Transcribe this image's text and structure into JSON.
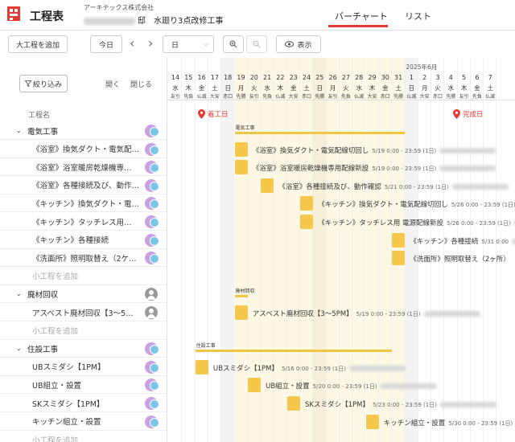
{
  "app": {
    "title": "工程表",
    "company": "アーキテックス株式会社",
    "project_suffix": "邸　水廻り3点改修工事"
  },
  "tabs": [
    {
      "label": "バーチャート",
      "active": true
    },
    {
      "label": "リスト",
      "active": false
    }
  ],
  "toolbar": {
    "add_major": "大工程を追加",
    "today": "今日",
    "view_unit": "日",
    "show_label": "表示"
  },
  "left": {
    "filter_label": "絞り込み",
    "expand_label": "開く",
    "collapse_label": "閉じる",
    "column_header": "工程名",
    "add_sub": "小工程を追加"
  },
  "milestones": {
    "start": "着工日",
    "end": "完成日"
  },
  "calendar": {
    "month_label": "2025年6月",
    "days": [
      {
        "d": "14",
        "w": "水",
        "r": "友引"
      },
      {
        "d": "15",
        "w": "木",
        "r": "先負"
      },
      {
        "d": "16",
        "w": "金",
        "r": "仏滅"
      },
      {
        "d": "17",
        "w": "土",
        "r": "大安"
      },
      {
        "d": "18",
        "w": "日",
        "r": "赤口"
      },
      {
        "d": "19",
        "w": "月",
        "r": "先勝"
      },
      {
        "d": "20",
        "w": "火",
        "r": "友引"
      },
      {
        "d": "21",
        "w": "水",
        "r": "先負"
      },
      {
        "d": "22",
        "w": "木",
        "r": "仏滅"
      },
      {
        "d": "23",
        "w": "金",
        "r": "大安"
      },
      {
        "d": "24",
        "w": "土",
        "r": "赤口"
      },
      {
        "d": "25",
        "w": "日",
        "r": "先勝"
      },
      {
        "d": "26",
        "w": "月",
        "r": "友引"
      },
      {
        "d": "27",
        "w": "火",
        "r": "先負"
      },
      {
        "d": "28",
        "w": "水",
        "r": "仏滅"
      },
      {
        "d": "29",
        "w": "木",
        "r": "大安"
      },
      {
        "d": "30",
        "w": "金",
        "r": "赤口"
      },
      {
        "d": "31",
        "w": "土",
        "r": "先勝"
      },
      {
        "d": "1",
        "w": "日",
        "r": "仏滅"
      },
      {
        "d": "2",
        "w": "月",
        "r": "大安"
      },
      {
        "d": "3",
        "w": "火",
        "r": "赤口"
      },
      {
        "d": "4",
        "w": "水",
        "r": "先勝"
      },
      {
        "d": "5",
        "w": "木",
        "r": "友引"
      },
      {
        "d": "6",
        "w": "金",
        "r": "先負"
      },
      {
        "d": "7",
        "w": "土",
        "r": "仏滅"
      }
    ]
  },
  "groups": [
    {
      "name": "電気工事",
      "short": "電気工事",
      "tasks": [
        {
          "name": "《浴室》換気ダクト・電気配…",
          "bar_label": "《浴室》換気ダクト・電気配線切回し",
          "time": "5/19 0:00 - 23:59 (1日)"
        },
        {
          "name": "《浴室》浴室暖房乾燥機専…",
          "bar_label": "《浴室》浴室暖房乾燥機専用配線新設",
          "time": "5/19 0:00 - 23:59 (1日)"
        },
        {
          "name": "《浴室》各種接続及び、動作…",
          "bar_label": "《浴室》各種接続及び、動作確認",
          "time": "5/21 0:00 - 23:59 (1日)"
        },
        {
          "name": "《キッチン》換気ダクト・電…",
          "bar_label": "《キッチン》換気ダクト・電気配線切回し",
          "time": "5/26 0:00 - 23:59 (1日)"
        },
        {
          "name": "《キッチン》タッチレス用…",
          "bar_label": "《キッチン》タッチレス用 電源配線新設",
          "time": "5/26 0:00 - 23:59 (1日)"
        },
        {
          "name": "《キッチン》各種接続",
          "bar_label": "《キッチン》各種接続",
          "time": "5/31 0:00"
        },
        {
          "name": "《洗面所》照明取替え（2ケ…",
          "bar_label": "《洗面所》照明取替え（2ヶ所）",
          "time": ""
        }
      ]
    },
    {
      "name": "廃材回収",
      "short": "廃材回収",
      "tasks": [
        {
          "name": "アスベスト廃材回収【3〜5…",
          "bar_label": "アスベスト廃材回収【3〜5PM】",
          "time": "5/19 0:00 - 23:59 (1日)"
        }
      ]
    },
    {
      "name": "住設工事",
      "short": "住設工事",
      "tasks": [
        {
          "name": "UBスミダシ【1PM】",
          "bar_label": "UBスミダシ【1PM】",
          "time": "5/16 0:00 - 23:59 (1日)"
        },
        {
          "name": "UB組立・設置",
          "bar_label": "UB組立・設置",
          "time": "5/20 0:00 - 23:59 (1日)"
        },
        {
          "name": "SKスミダシ【1PM】",
          "bar_label": "SKスミダシ【1PM】",
          "time": "5/23 0:00 - 23:59 (1日)"
        },
        {
          "name": "キッチン組立・設置",
          "bar_label": "キッチン組立・設置",
          "time": "5/30 0:00 - 23:59 (1日)"
        }
      ]
    }
  ]
}
